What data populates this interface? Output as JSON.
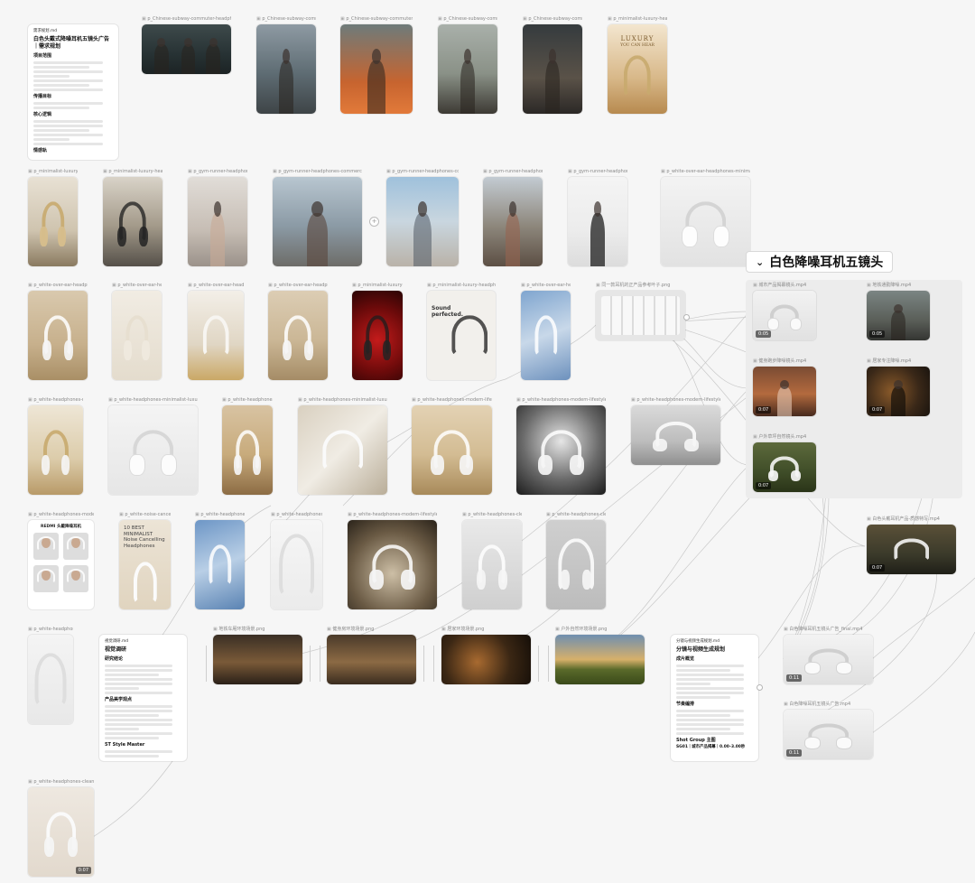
{
  "group": {
    "title": "白色降噪耳机五镜头",
    "chevron": "chevron-down-icon"
  },
  "docs": {
    "brief": {
      "label": "需求规划.md",
      "title": "白色头戴式降噪耳机五镜头广告｜需求规划",
      "h1": "项目范围",
      "h2": "传播目标",
      "h3": "核心逻辑",
      "h4": "情感轨"
    },
    "research": {
      "label": "视觉调研.md",
      "title": "视觉调研",
      "h1": "研究结论",
      "h2": "产品美学观点",
      "h3": "5T Style Master"
    },
    "storyboard": {
      "label": "分镜与视频生成规划.md",
      "title": "分镜与视频生成规划",
      "h1": "成片概览",
      "h2": "节奏编排",
      "h3": "Shot Group 主图",
      "h4": "SG01｜城市产品揭幕｜0.00–3.00秒"
    }
  },
  "images": [
    {
      "id": "r0c1",
      "label": "p_Chinese-subway-commuter-headphones-...",
      "duration": ""
    },
    {
      "id": "r0c2",
      "label": "p_Chinese-subway-commut...",
      "duration": ""
    },
    {
      "id": "r0c3",
      "label": "p_Chinese-subway-commuter-...",
      "duration": ""
    },
    {
      "id": "r0c4",
      "label": "p_Chinese-subway-commut...",
      "duration": ""
    },
    {
      "id": "r0c5",
      "label": "p_Chinese-subway-commut...",
      "duration": ""
    },
    {
      "id": "r0c6",
      "label": "p_minimalist-luxury-headph...",
      "duration": ""
    },
    {
      "id": "r1c0",
      "label": "p_minimalist-luxury-h...",
      "duration": ""
    },
    {
      "id": "r1c1",
      "label": "p_minimalist-luxury-headph...",
      "duration": ""
    },
    {
      "id": "r1c2",
      "label": "p_gym-runner-headphones-...",
      "duration": ""
    },
    {
      "id": "r1c3",
      "label": "p_gym-runner-headphones-commercial-phot...",
      "duration": ""
    },
    {
      "id": "r1c4",
      "label": "p_gym-runner-headphones-commercial-...",
      "duration": ""
    },
    {
      "id": "r1c5",
      "label": "p_gym-runner-headphones-...",
      "duration": ""
    },
    {
      "id": "r1c6",
      "label": "p_gym-runner-headphones-co...",
      "duration": ""
    },
    {
      "id": "r1c7",
      "label": "p_white-over-ear-headphones-minimalist-...",
      "duration": ""
    },
    {
      "id": "r2c0",
      "label": "p_white-over-ear-headphon...",
      "duration": ""
    },
    {
      "id": "r2c1",
      "label": "p_white-over-ear-hea...",
      "duration": ""
    },
    {
      "id": "r2c2",
      "label": "p_white-over-ear-headph...",
      "duration": ""
    },
    {
      "id": "r2c3",
      "label": "p_white-over-ear-headphon...",
      "duration": ""
    },
    {
      "id": "r2c4",
      "label": "p_minimalist-luxury-h...",
      "duration": ""
    },
    {
      "id": "r2c5",
      "label": "p_minimalist-luxury-headphon...",
      "duration": ""
    },
    {
      "id": "r2c6",
      "label": "p_white-over-ear-hea...",
      "duration": ""
    },
    {
      "id": "r2c7",
      "label": "同一款耳机的正产品参考叶子.png",
      "duration": ""
    },
    {
      "id": "r3c0",
      "label": "p_white-headphones-m...",
      "duration": ""
    },
    {
      "id": "r3c1",
      "label": "p_white-headphones-minimalist-luxury-comm...",
      "duration": ""
    },
    {
      "id": "r3c2",
      "label": "p_white-headphones-...",
      "duration": ""
    },
    {
      "id": "r3c3",
      "label": "p_white-headphones-minimalist-luxury-comm...",
      "duration": ""
    },
    {
      "id": "r3c4",
      "label": "p_white-headphones-modern-lifestyle-...",
      "duration": ""
    },
    {
      "id": "r3c5",
      "label": "p_white-headphones-modern-lifestyle-...",
      "duration": ""
    },
    {
      "id": "r3c6",
      "label": "p_white-headphones-modern-lifestyle-comm...",
      "duration": ""
    },
    {
      "id": "r4c0",
      "label": "p_white-headphones-modern-lif...",
      "duration": ""
    },
    {
      "id": "r4c1",
      "label": "p_white-noise-cancell...",
      "duration": ""
    },
    {
      "id": "r4c2",
      "label": "p_white-headphones-...",
      "duration": ""
    },
    {
      "id": "r4c3",
      "label": "p_white-headphones-m...",
      "duration": ""
    },
    {
      "id": "r4c4",
      "label": "p_white-headphones-modern-lifestyle-comm...",
      "duration": ""
    },
    {
      "id": "r4c5",
      "label": "p_white-headphones-clean-...",
      "duration": ""
    },
    {
      "id": "r4c6",
      "label": "p_white-headphones-clean-...",
      "duration": ""
    },
    {
      "id": "r5c0",
      "label": "p_white-headphones-...",
      "duration": ""
    },
    {
      "id": "r5c1",
      "label": "地铁车厢环境场景.png",
      "duration": ""
    },
    {
      "id": "r5c2",
      "label": "健身房环境场景.png",
      "duration": ""
    },
    {
      "id": "r5c3",
      "label": "居家环境场景.png",
      "duration": ""
    },
    {
      "id": "r5c4",
      "label": "户外自然环境场景.png",
      "duration": ""
    },
    {
      "id": "r6c0",
      "label": "p_white-headphones-clean-mat...",
      "duration": "0:07"
    },
    {
      "id": "v1",
      "label": "城市产品揭幕镜头.mp4",
      "duration": "0:05"
    },
    {
      "id": "v2",
      "label": "地铁通勤降噪.mp4",
      "duration": "0:05"
    },
    {
      "id": "v3",
      "label": "健身跑步降噪镜头.mp4",
      "duration": "0:07"
    },
    {
      "id": "v4",
      "label": "居家专注降噪.mp4",
      "duration": "0:07"
    },
    {
      "id": "v5",
      "label": "户外草坪自然镜头.mp4",
      "duration": "0:07"
    },
    {
      "id": "v6",
      "label": "白色头戴耳机产品-质感特写.mp4",
      "duration": "0:07"
    },
    {
      "id": "v7",
      "label": "白色降噪耳机五镜头广告_final.mp4",
      "duration": "0:11"
    },
    {
      "id": "v8",
      "label": "白色降噪耳机五镜头广告.mp4",
      "duration": "0:11"
    }
  ],
  "poster_texts": {
    "luxury": "LUXURY",
    "luxury_sub": "YOU CAN HEAR",
    "sound": "Sound perfected.",
    "best": "10 BEST MINIMALIST Noise Cancelling Headphones",
    "redmi": "REDMI 头戴降噪耳机"
  }
}
